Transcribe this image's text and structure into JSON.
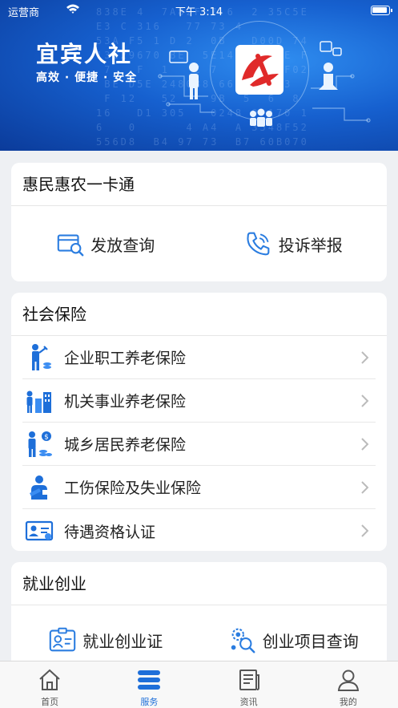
{
  "status_bar": {
    "carrier": "运营商",
    "time": "下午 3:14"
  },
  "banner": {
    "title": "宜宾人社",
    "slogan": "高效 · 便捷 · 安全"
  },
  "card1": {
    "title": "惠民惠农一卡通",
    "items": [
      {
        "label": "发放查询",
        "icon": "search-card-icon"
      },
      {
        "label": "投诉举报",
        "icon": "phone-icon"
      }
    ]
  },
  "card2": {
    "title": "社会保险",
    "items": [
      {
        "label": "企业职工养老保险",
        "icon": "worker-icon"
      },
      {
        "label": "机关事业养老保险",
        "icon": "institution-icon"
      },
      {
        "label": "城乡居民养老保险",
        "icon": "resident-coins-icon"
      },
      {
        "label": "工伤保险及失业保险",
        "icon": "injury-icon"
      },
      {
        "label": "待遇资格认证",
        "icon": "certificate-icon"
      }
    ]
  },
  "card3": {
    "title": "就业创业",
    "items": [
      {
        "label": "就业创业证",
        "icon": "id-card-icon"
      },
      {
        "label": "创业项目查询",
        "icon": "gear-search-icon"
      }
    ]
  },
  "tabbar": [
    {
      "label": "首页",
      "icon": "home-icon",
      "active": false
    },
    {
      "label": "服务",
      "icon": "service-icon",
      "active": true
    },
    {
      "label": "资讯",
      "icon": "news-icon",
      "active": false
    },
    {
      "label": "我的",
      "icon": "user-icon",
      "active": false
    }
  ],
  "colors": {
    "accent": "#1e6fd9",
    "banner": "#1660cf",
    "logo_red": "#e02a2a"
  }
}
